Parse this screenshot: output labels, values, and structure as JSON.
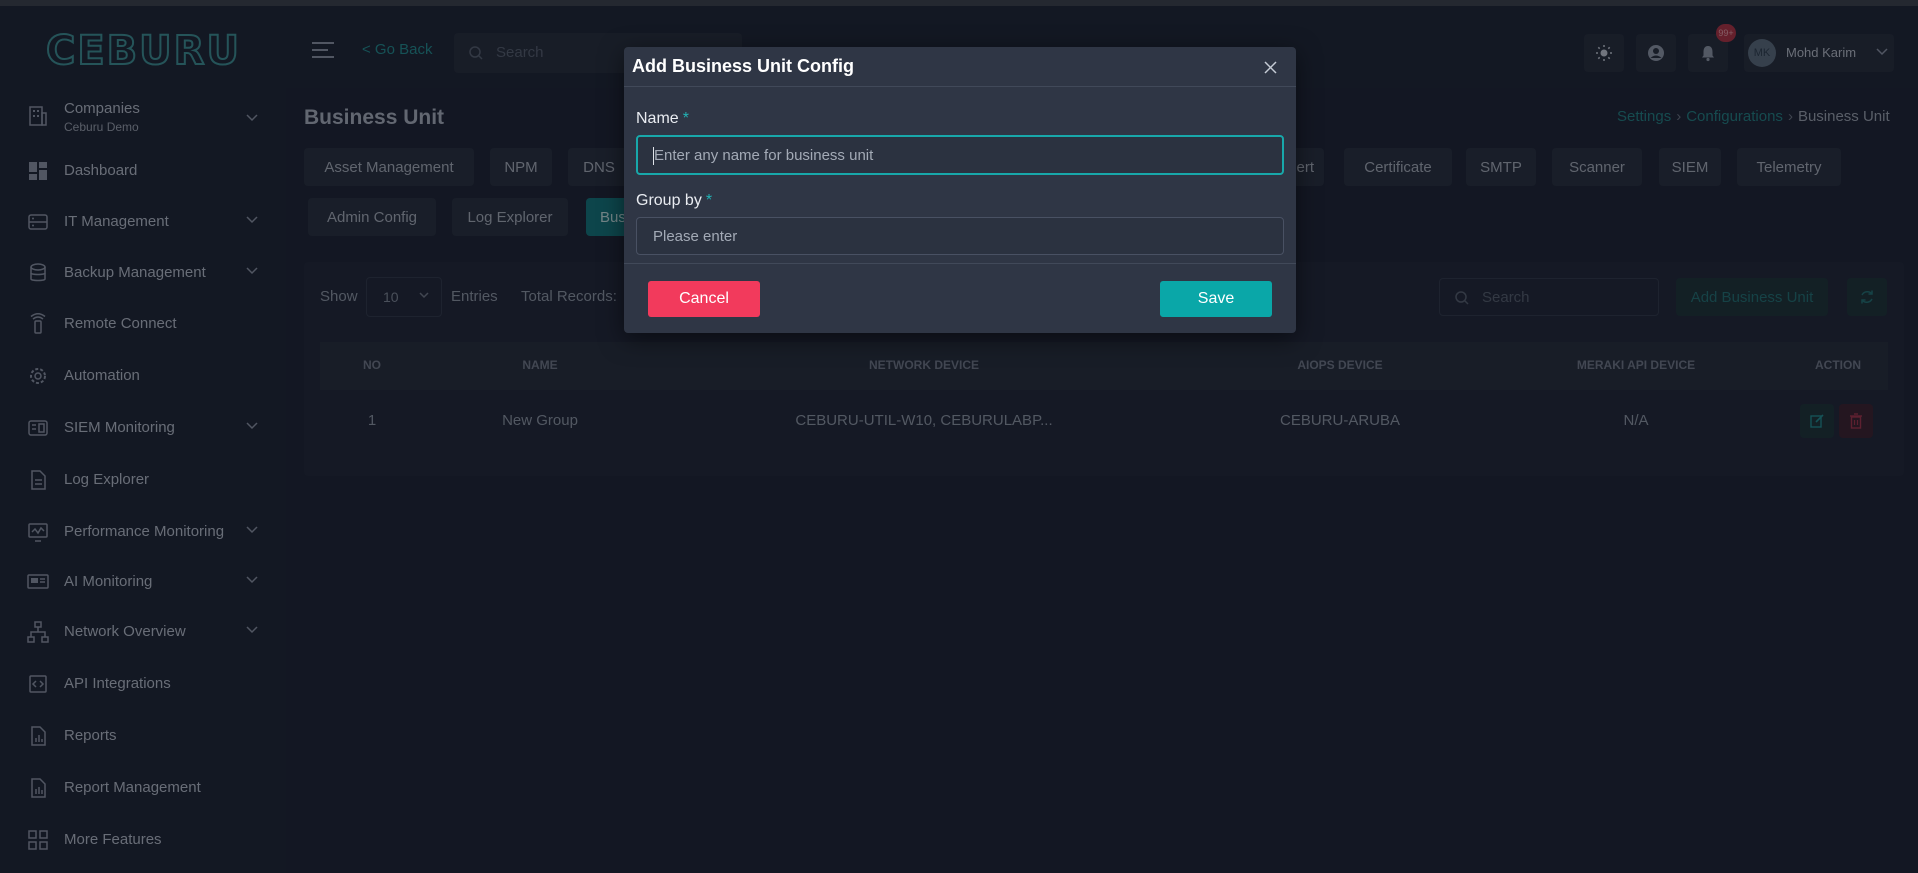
{
  "header": {
    "logo": "CEBURU",
    "go_back": "< Go Back",
    "search_placeholder": "Search",
    "notification_count": "99+",
    "user_initials": "MK",
    "user_name": "Mohd Karim"
  },
  "sidebar": {
    "company_label": "Companies",
    "company_name": "Ceburu Demo",
    "items": [
      {
        "label": "Dashboard",
        "icon": "dashboard-icon"
      },
      {
        "label": "IT Management",
        "icon": "server-icon"
      },
      {
        "label": "Backup Management",
        "icon": "database-icon"
      },
      {
        "label": "Remote Connect",
        "icon": "remote-icon"
      },
      {
        "label": "Automation",
        "icon": "gear-icon"
      },
      {
        "label": "SIEM Monitoring",
        "icon": "siem-icon"
      },
      {
        "label": "Log Explorer",
        "icon": "file-icon"
      },
      {
        "label": "Performance Monitoring",
        "icon": "monitor-icon"
      },
      {
        "label": "AI Monitoring",
        "icon": "ai-icon"
      },
      {
        "label": "Network Overview",
        "icon": "network-icon"
      },
      {
        "label": "API Integrations",
        "icon": "api-icon"
      },
      {
        "label": "Reports",
        "icon": "report-icon"
      },
      {
        "label": "Report Management",
        "icon": "report-management-icon"
      },
      {
        "label": "More Features",
        "icon": "grid-icon"
      }
    ]
  },
  "page": {
    "title": "Business Unit",
    "breadcrumb": [
      "Settings",
      "Configurations",
      "Business Unit"
    ]
  },
  "tabs": [
    "Asset Management",
    "NPM",
    "DNS",
    "ert",
    "Certificate",
    "SMTP",
    "Scanner",
    "SIEM",
    "Telemetry",
    "Admin Config",
    "Log Explorer",
    "Bus"
  ],
  "table": {
    "show_label": "Show",
    "page_size": "10",
    "entries_label": "Entries",
    "total_records_label": "Total Records:",
    "search_placeholder": "Search",
    "add_button": "Add Business Unit",
    "columns": [
      "NO",
      "NAME",
      "NETWORK DEVICE",
      "AIOPS DEVICE",
      "MERAKI API DEVICE",
      "ACTION"
    ],
    "rows": [
      {
        "no": "1",
        "name": "New Group",
        "network_device": "CEBURU-UTIL-W10, CEBURULABP...",
        "aiops_device": "CEBURU-ARUBA",
        "meraki_device": "N/A"
      }
    ]
  },
  "modal": {
    "title": "Add Business Unit Config",
    "name_label": "Name",
    "required_mark": "*",
    "name_placeholder": "Enter any name for business unit",
    "group_label": "Group by",
    "group_placeholder": "Please enter",
    "cancel": "Cancel",
    "save": "Save"
  },
  "colors": {
    "accent": "#0aa7a8",
    "danger": "#f23a5c",
    "background": "#1b2130"
  }
}
